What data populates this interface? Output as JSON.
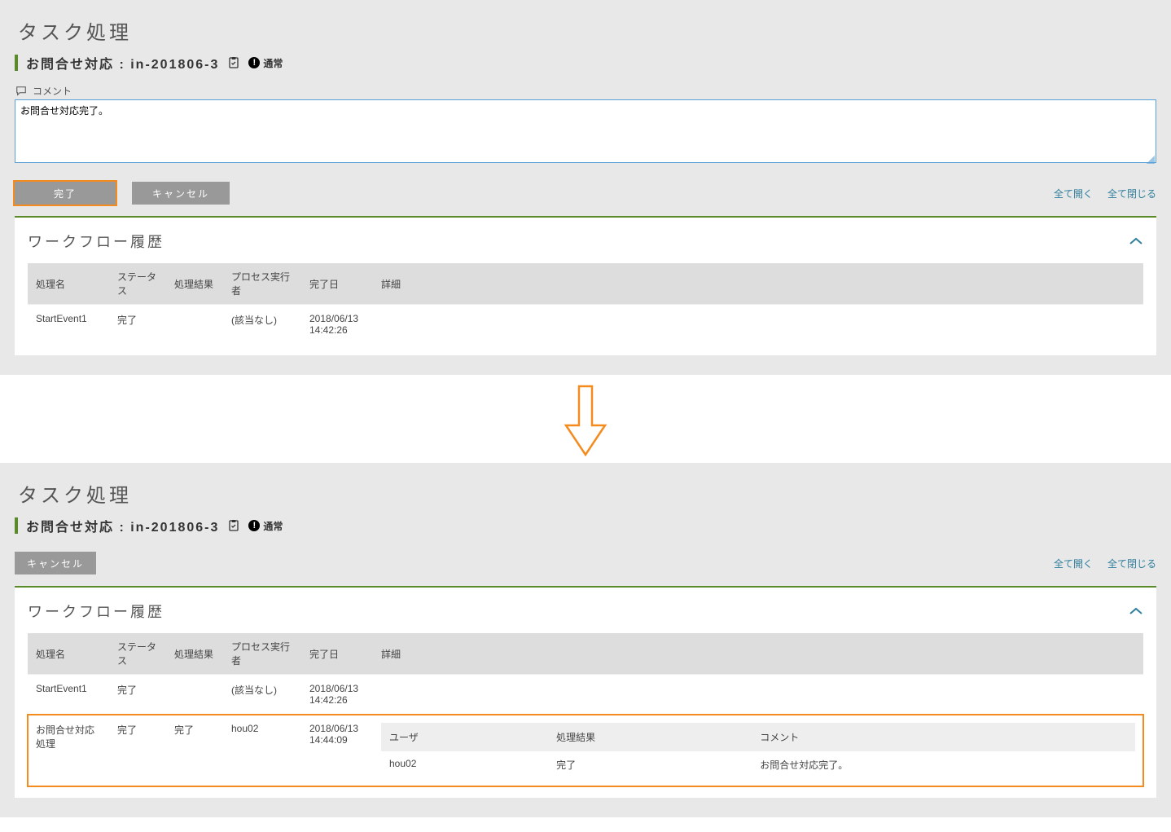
{
  "panel1": {
    "page_title": "タスク処理",
    "task_title": "お問合せ対応 : in-201806-3",
    "priority_label": "通常",
    "comment_label": "コメント",
    "comment_value": "お問合せ対応完了。",
    "buttons": {
      "complete": "完了",
      "cancel": "キャンセル"
    },
    "links": {
      "expand_all": "全て開く",
      "collapse_all": "全て閉じる"
    },
    "history_title": "ワークフロー履歴",
    "columns": [
      "処理名",
      "ステータス",
      "処理結果",
      "プロセス実行者",
      "完了日",
      "詳細"
    ],
    "rows": [
      {
        "name": "StartEvent1",
        "status": "完了",
        "result": "",
        "executor": "(該当なし)",
        "completed": "2018/06/13 14:42:26",
        "detail": ""
      }
    ]
  },
  "panel2": {
    "page_title": "タスク処理",
    "task_title": "お問合せ対応 : in-201806-3",
    "priority_label": "通常",
    "buttons": {
      "cancel": "キャンセル"
    },
    "links": {
      "expand_all": "全て開く",
      "collapse_all": "全て閉じる"
    },
    "history_title": "ワークフロー履歴",
    "columns": [
      "処理名",
      "ステータス",
      "処理結果",
      "プロセス実行者",
      "完了日",
      "詳細"
    ],
    "rows": [
      {
        "name": "StartEvent1",
        "status": "完了",
        "result": "",
        "executor": "(該当なし)",
        "completed": "2018/06/13 14:42:26",
        "detail": null
      },
      {
        "name": "お問合せ対応処理",
        "status": "完了",
        "result": "完了",
        "executor": "hou02",
        "completed": "2018/06/13 14:44:09",
        "detail": {
          "columns": [
            "ユーザ",
            "処理結果",
            "コメント"
          ],
          "rows": [
            {
              "user": "hou02",
              "result": "完了",
              "comment": "お問合せ対応完了。"
            }
          ]
        }
      }
    ]
  }
}
